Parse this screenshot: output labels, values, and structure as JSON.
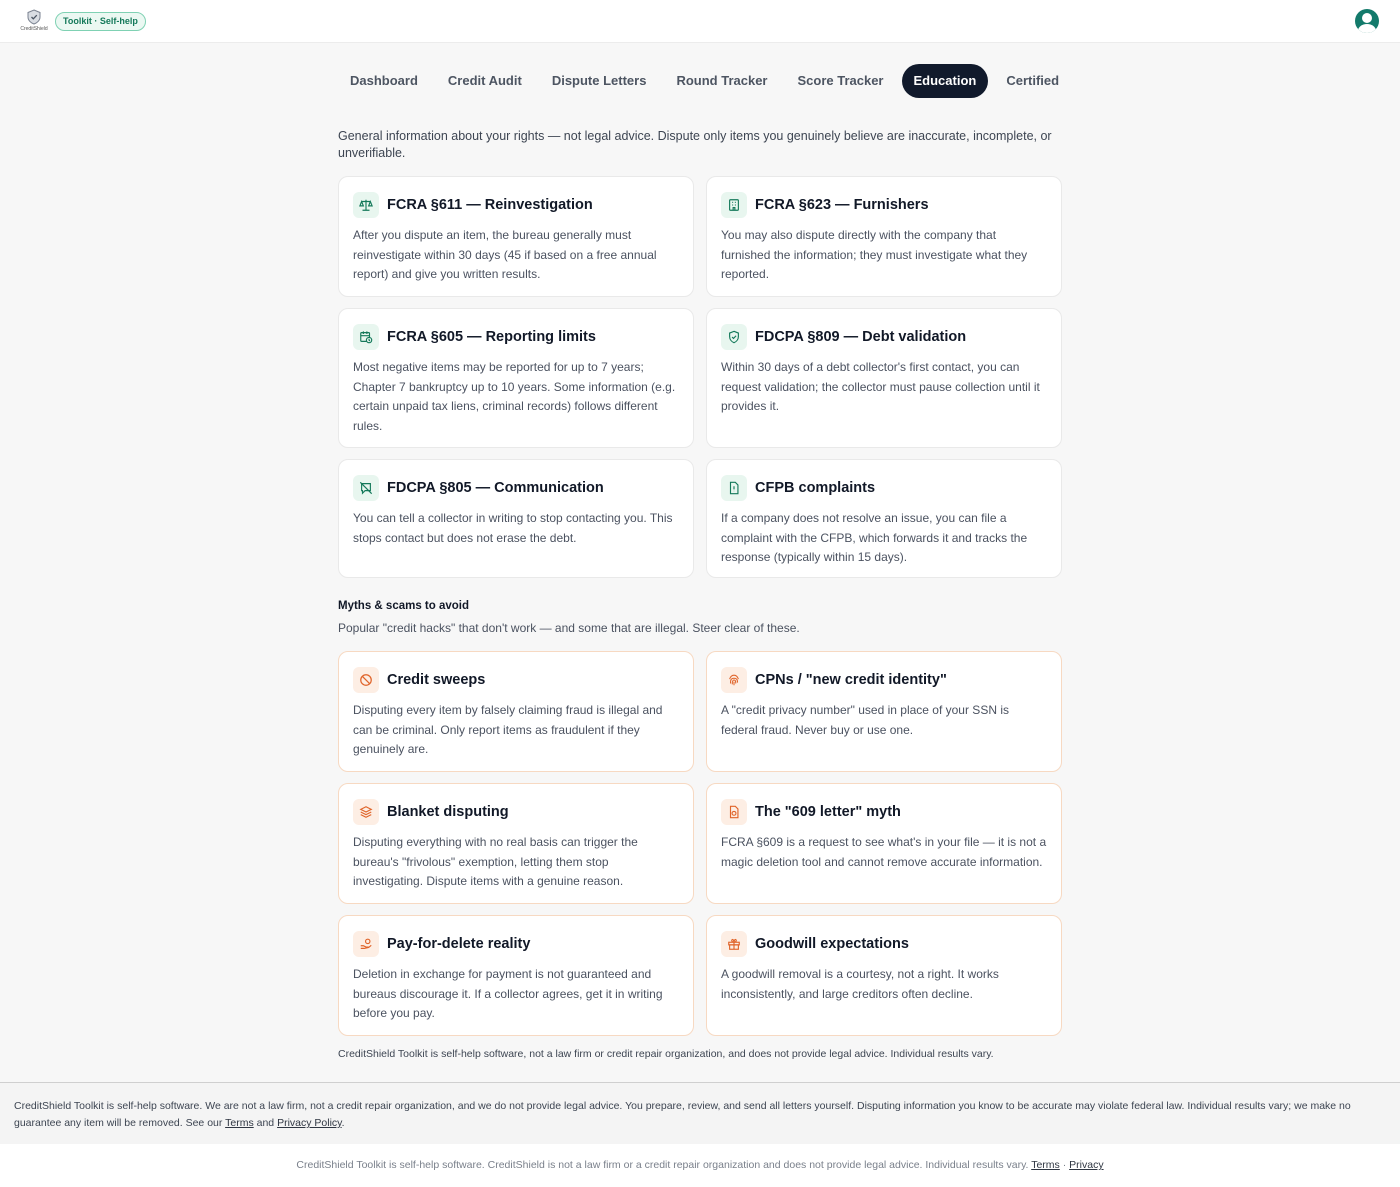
{
  "header": {
    "logo_text": "CreditShield",
    "badge": "Toolkit · Self-help"
  },
  "tabs": [
    {
      "label": "Dashboard"
    },
    {
      "label": "Credit Audit"
    },
    {
      "label": "Dispute Letters"
    },
    {
      "label": "Round Tracker"
    },
    {
      "label": "Score Tracker"
    },
    {
      "label": "Education",
      "active": true
    },
    {
      "label": "Certified Mail"
    }
  ],
  "intro": "General information about your rights — not legal advice. Dispute only items you genuinely believe are inaccurate, incomplete, or unverifiable.",
  "rights": [
    {
      "icon": "scale-icon",
      "title": "FCRA §611 — Reinvestigation",
      "body": "After you dispute an item, the bureau generally must reinvestigate within 30 days (45 if based on a free annual report) and give you written results."
    },
    {
      "icon": "building-icon",
      "title": "FCRA §623 — Furnishers",
      "body": "You may also dispute directly with the company that furnished the information; they must investigate what they reported."
    },
    {
      "icon": "calendar-clock-icon",
      "title": "FCRA §605 — Reporting limits",
      "body": "Most negative items may be reported for up to 7 years; Chapter 7 bankruptcy up to 10 years. Some information (e.g. certain unpaid tax liens, criminal records) follows different rules."
    },
    {
      "icon": "shield-check-icon",
      "title": "FDCPA §809 — Debt validation",
      "body": "Within 30 days of a debt collector's first contact, you can request validation; the collector must pause collection until it provides it."
    },
    {
      "icon": "message-off-icon",
      "title": "FDCPA §805 — Communication",
      "body": "You can tell a collector in writing to stop contacting you. This stops contact but does not erase the debt."
    },
    {
      "icon": "file-alert-icon",
      "title": "CFPB complaints",
      "body": "If a company does not resolve an issue, you can file a complaint with the CFPB, which forwards it and tracks the response (typically within 15 days)."
    }
  ],
  "myths_section": {
    "title": "Myths & scams to avoid",
    "subtitle": "Popular \"credit hacks\" that don't work — and some that are illegal. Steer clear of these."
  },
  "myths": [
    {
      "icon": "ban-icon",
      "title": "Credit sweeps",
      "body": "Disputing every item by falsely claiming fraud is illegal and can be criminal. Only report items as fraudulent if they genuinely are."
    },
    {
      "icon": "fingerprint-icon",
      "title": "CPNs / \"new credit identity\"",
      "body": "A \"credit privacy number\" used in place of your SSN is federal fraud. Never buy or use one."
    },
    {
      "icon": "layers-icon",
      "title": "Blanket disputing",
      "body": "Disputing everything with no real basis can trigger the bureau's \"frivolous\" exemption, letting them stop investigating. Dispute items with a genuine reason."
    },
    {
      "icon": "file-warning-icon",
      "title": "The \"609 letter\" myth",
      "body": "FCRA §609 is a request to see what's in your file — it is not a magic deletion tool and cannot remove accurate information."
    },
    {
      "icon": "hand-coins-icon",
      "title": "Pay-for-delete reality",
      "body": "Deletion in exchange for payment is not guaranteed and bureaus discourage it. If a collector agrees, get it in writing before you pay."
    },
    {
      "icon": "gift-icon",
      "title": "Goodwill expectations",
      "body": "A goodwill removal is a courtesy, not a right. It works inconsistently, and large creditors often decline."
    }
  ],
  "page_disclaimer": "CreditShield Toolkit is self-help software, not a law firm or credit repair organization, and does not provide legal advice. Individual results vary.",
  "footer": {
    "text": "CreditShield Toolkit is self-help software. We are not a law firm, not a credit repair organization, and we do not provide legal advice. You prepare, review, and send all letters yourself. Disputing information you know to be accurate may violate federal law. Individual results vary; we make no guarantee any item will be removed. See our",
    "terms": "Terms",
    "and": "and",
    "privacy_policy": "Privacy Policy",
    "end": "."
  },
  "bottom": {
    "text": "CreditShield Toolkit is self-help software. CreditShield is not a law firm or a credit repair organization and does not provide legal advice. Individual results vary.",
    "terms": "Terms",
    "sep": "·",
    "privacy": "Privacy"
  },
  "colors": {
    "accent_green": "#14795a",
    "warn_orange": "#e0642a",
    "active_tab": "#111a2c"
  }
}
